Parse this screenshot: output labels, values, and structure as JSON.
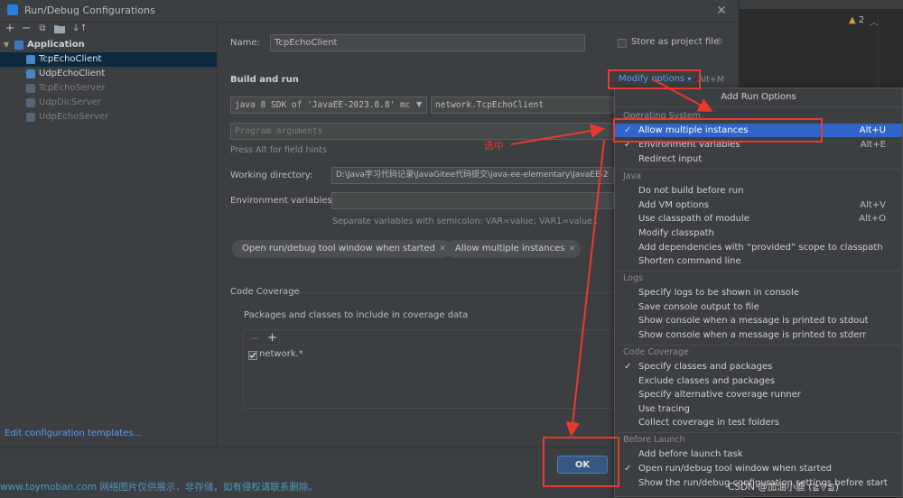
{
  "window": {
    "title": "Run/Debug Configurations"
  },
  "left_toolbar": {
    "icons": [
      "add-icon",
      "remove-icon",
      "copy-icon",
      "folder-icon",
      "sort-icon"
    ]
  },
  "tree": {
    "root": "Application",
    "items": [
      {
        "label": "TcpEchoClient",
        "selected": true,
        "enabled": true
      },
      {
        "label": "UdpEchoClient",
        "selected": false,
        "enabled": true
      },
      {
        "label": "TcpEchoServer",
        "selected": false,
        "enabled": false
      },
      {
        "label": "UdpDicServer",
        "selected": false,
        "enabled": false
      },
      {
        "label": "UdpEchoServer",
        "selected": false,
        "enabled": false
      }
    ]
  },
  "edit_templates": "Edit configuration templates...",
  "form": {
    "name_label": "Name:",
    "name_value": "TcpEchoClient",
    "store_label": "Store as project file",
    "build_run_title": "Build and run",
    "modify_options": "Modify options",
    "modify_shortcut": "Alt+M",
    "sdk_value": "java 8 SDK of 'JavaEE-2023.8.8' mc",
    "main_class": "network.TcpEchoClient",
    "program_args_placeholder": "Program arguments",
    "field_hint": "Press Alt for field hints",
    "working_dir_label": "Working directory:",
    "working_dir_value": "D:\\Java学习代码记录\\JavaGitee代码提交\\java-ee-elementary\\JavaEE-2",
    "env_label": "Environment variables:",
    "env_hint": "Separate variables with semicolon: VAR=value; VAR1=value1",
    "chips": [
      "Open run/debug tool window when started",
      "Allow multiple instances"
    ],
    "coverage_title": "Code Coverage",
    "coverage_sub": "Packages and classes to include in coverage data",
    "coverage_item": "network.*"
  },
  "ok_label": "OK",
  "ide": {
    "warnings": "2"
  },
  "popup": {
    "title": "Add Run Options",
    "groups": [
      {
        "name": "Operating System",
        "options": [
          {
            "label": "Allow multiple instances",
            "shortcut": "Alt+U",
            "checked": true,
            "highlighted": true
          },
          {
            "label": "Environment variables",
            "shortcut": "Alt+E",
            "checked": true,
            "highlighted": false
          },
          {
            "label": "Redirect input",
            "shortcut": "",
            "checked": false,
            "highlighted": false
          }
        ]
      },
      {
        "name": "Java",
        "options": [
          {
            "label": "Do not build before run",
            "shortcut": "",
            "checked": false
          },
          {
            "label": "Add VM options",
            "shortcut": "Alt+V",
            "checked": false
          },
          {
            "label": "Use classpath of module",
            "shortcut": "Alt+O",
            "checked": false
          },
          {
            "label": "Modify classpath",
            "shortcut": "",
            "checked": false
          },
          {
            "label": "Add dependencies with “provided” scope to classpath",
            "shortcut": "",
            "checked": false
          },
          {
            "label": "Shorten command line",
            "shortcut": "",
            "checked": false
          }
        ]
      },
      {
        "name": "Logs",
        "options": [
          {
            "label": "Specify logs to be shown in console",
            "shortcut": "",
            "checked": false
          },
          {
            "label": "Save console output to file",
            "shortcut": "",
            "checked": false
          },
          {
            "label": "Show console when a message is printed to stdout",
            "shortcut": "",
            "checked": false
          },
          {
            "label": "Show console when a message is printed to stderr",
            "shortcut": "",
            "checked": false
          }
        ]
      },
      {
        "name": "Code Coverage",
        "options": [
          {
            "label": "Specify classes and packages",
            "shortcut": "",
            "checked": true
          },
          {
            "label": "Exclude classes and packages",
            "shortcut": "",
            "checked": false
          },
          {
            "label": "Specify alternative coverage runner",
            "shortcut": "",
            "checked": false
          },
          {
            "label": "Use tracing",
            "shortcut": "",
            "checked": false
          },
          {
            "label": "Collect coverage in test folders",
            "shortcut": "",
            "checked": false
          }
        ]
      },
      {
        "name": "Before Launch",
        "options": [
          {
            "label": "Add before launch task",
            "shortcut": "",
            "checked": false
          },
          {
            "label": "Open run/debug tool window when started",
            "shortcut": "",
            "checked": true
          },
          {
            "label": "Show the run/debug configuration settings before start",
            "shortcut": "",
            "checked": false
          }
        ]
      }
    ]
  },
  "annotation": {
    "text": "选中",
    "color": "#e83a2c"
  },
  "watermark": "www.toymoban.com 网络图片仅供展示，非存储，如有侵权请联系删除。",
  "watermark_right": "CSDN @加油小鹿 (≧▽≦)"
}
